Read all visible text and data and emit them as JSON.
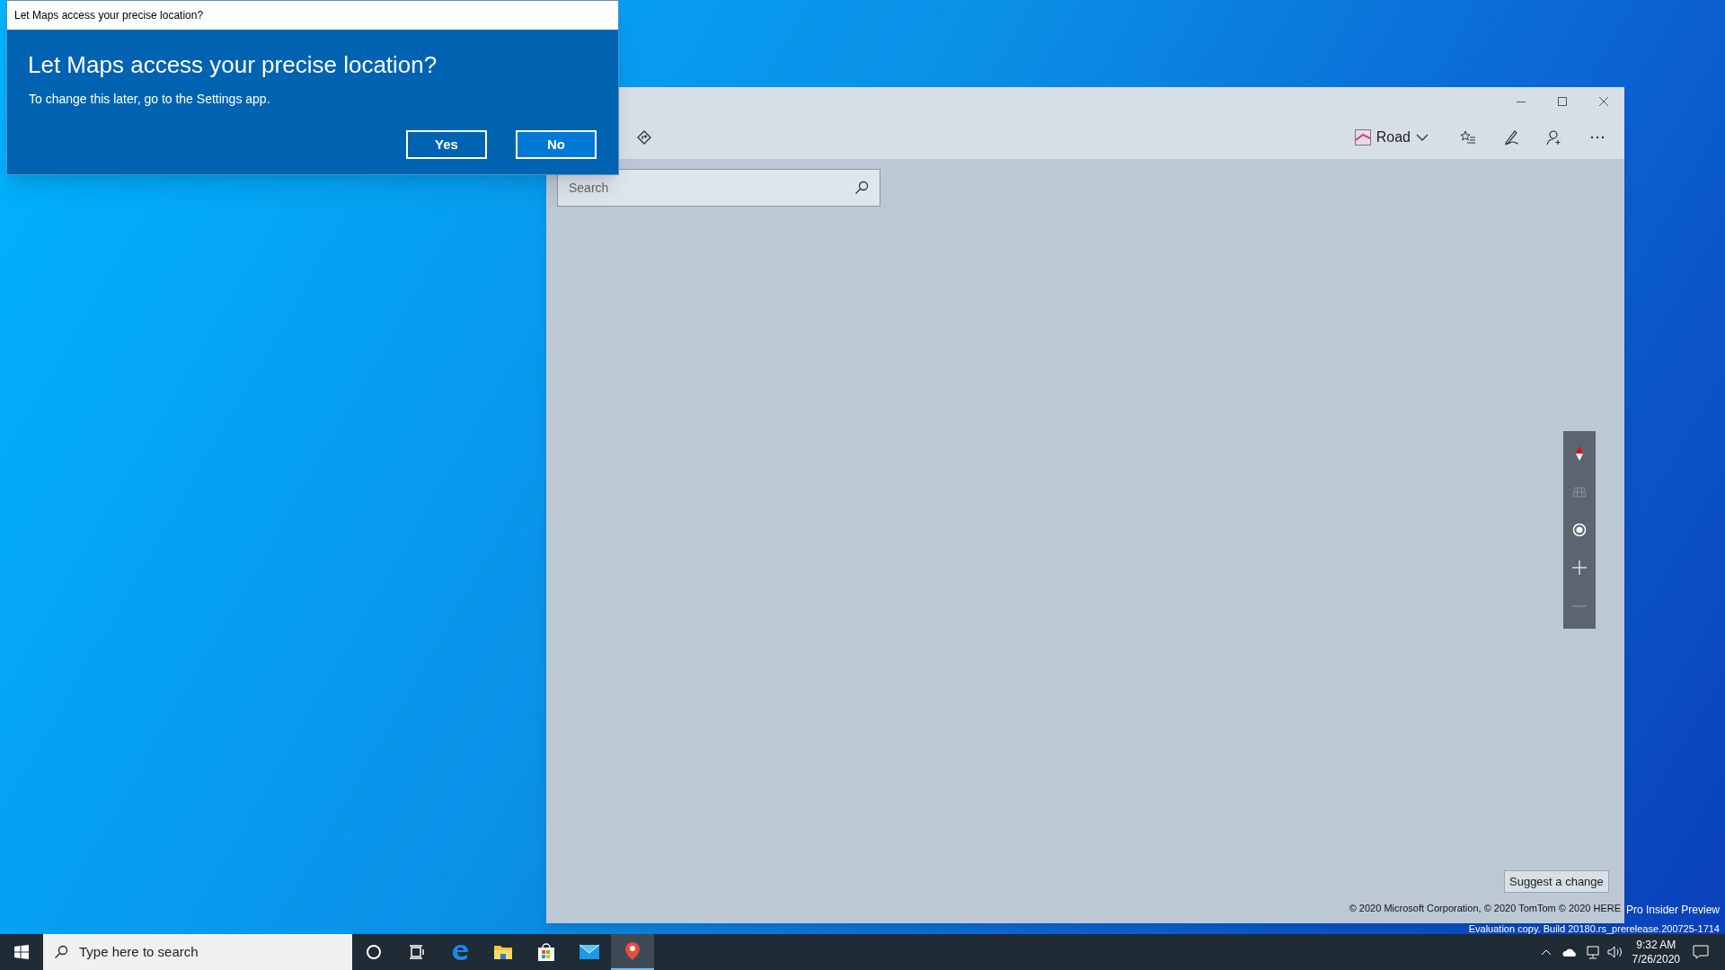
{
  "dialog": {
    "title": "Let Maps access your precise location?",
    "heading": "Let Maps access your precise location?",
    "message": "To change this later, go to the Settings app.",
    "buttons": [
      {
        "label": "Yes",
        "kind": "secondary"
      },
      {
        "label": "No",
        "kind": "primary"
      }
    ]
  },
  "maps": {
    "map_style": "Road",
    "search": {
      "placeholder": "Search"
    },
    "suggest_button": "Suggest a change",
    "copyright": "© 2020 Microsoft Corporation, © 2020 TomTom © 2020 HERE"
  },
  "desktop": {
    "edition": "Pro Insider Preview",
    "build": "Evaluation copy. Build 20180.rs_prerelease.200725-1714"
  },
  "taskbar": {
    "search": {
      "placeholder": "Type here to search"
    },
    "apps": [
      {
        "kind": "cortana",
        "selected": false
      },
      {
        "kind": "taskview",
        "selected": false
      },
      {
        "kind": "edge",
        "selected": false
      },
      {
        "kind": "explorer",
        "selected": false
      },
      {
        "kind": "store",
        "selected": false
      },
      {
        "kind": "mail",
        "selected": false
      },
      {
        "kind": "maps",
        "selected": true
      }
    ],
    "time": "9:32 AM",
    "date": "7/26/2020"
  }
}
